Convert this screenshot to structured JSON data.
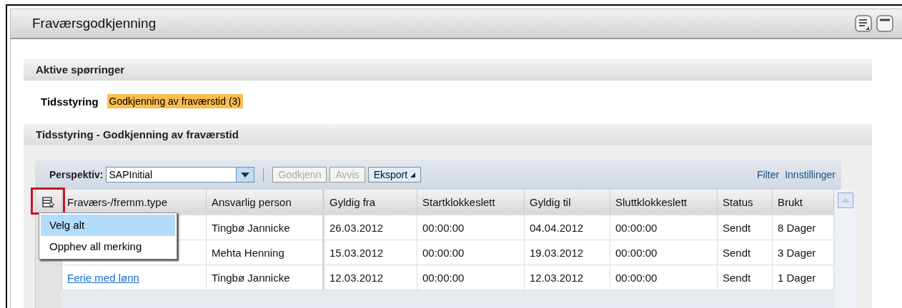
{
  "window": {
    "title": "Fraværsgodkjenning"
  },
  "active_queries": {
    "title": "Aktive spørringer",
    "category": "Tidsstyring",
    "query": "Godkjenning av fraværstid (3)"
  },
  "results": {
    "title": "Tidsstyring - Godkjenning av fraværstid",
    "toolbar": {
      "perspective_label": "Perspektiv:",
      "perspective_value": "SAPInitial",
      "buttons": [
        {
          "label": "Godkjenn",
          "disabled": true,
          "menu": false
        },
        {
          "label": "Avvis",
          "disabled": true,
          "menu": false
        },
        {
          "label": "Eksport",
          "disabled": false,
          "menu": true
        }
      ],
      "links": [
        "Filter",
        "Innstillinger"
      ]
    },
    "table": {
      "columns": [
        "Fraværs-/fremm.type",
        "Ansvarlig person",
        "Gyldig fra",
        "Startklokkeslett",
        "Gyldig til",
        "Sluttklokkeslett",
        "Status",
        "Brukt"
      ],
      "rows": [
        {
          "cells": [
            null,
            "Tingbø Jannicke",
            "26.03.2012",
            "00:00:00",
            "04.04.2012",
            "00:00:00",
            "Sendt",
            "8 Dager"
          ]
        },
        {
          "cells": [
            null,
            "Mehta Henning",
            "15.03.2012",
            "00:00:00",
            "19.03.2012",
            "00:00:00",
            "Sendt",
            "3 Dager"
          ]
        },
        {
          "cells": [
            "Ferie med lønn",
            "Tingbø Jannicke",
            "12.03.2012",
            "00:00:00",
            "12.03.2012",
            "00:00:00",
            "Sendt",
            "1 Dager"
          ]
        }
      ]
    },
    "selection_menu": [
      {
        "label": "Velg alt",
        "selected": true
      },
      {
        "label": "Opphev all merking",
        "selected": false
      }
    ]
  }
}
